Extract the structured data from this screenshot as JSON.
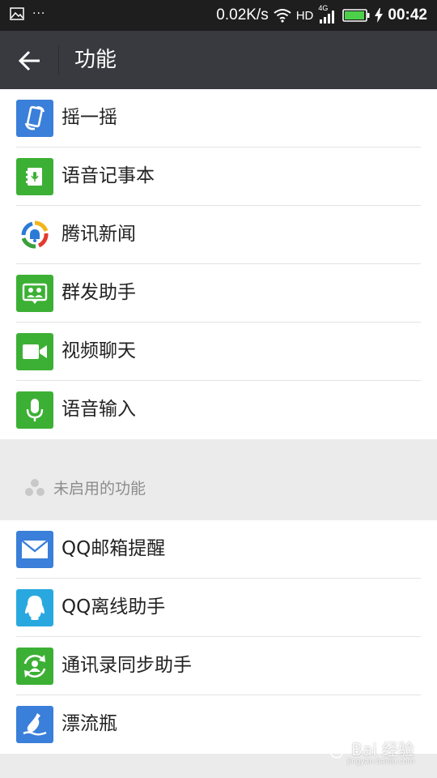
{
  "status_bar": {
    "left_icons": [
      "image-icon",
      "more-icon"
    ],
    "net_speed": "0.02K/s",
    "hd": "HD",
    "network": "4G",
    "time": "00:42"
  },
  "header": {
    "title": "功能"
  },
  "enabled_features": [
    {
      "label": "摇一摇",
      "icon": "shake-icon",
      "color": "#3a7fd9"
    },
    {
      "label": "语音记事本",
      "icon": "voice-notepad-icon",
      "color": "#3cb034"
    },
    {
      "label": "腾讯新闻",
      "icon": "tencent-news-icon",
      "color": "#ffffff"
    },
    {
      "label": "群发助手",
      "icon": "broadcast-icon",
      "color": "#3cb034"
    },
    {
      "label": "视频聊天",
      "icon": "video-chat-icon",
      "color": "#3cb034"
    },
    {
      "label": "语音输入",
      "icon": "microphone-icon",
      "color": "#3cb034"
    }
  ],
  "disabled_section": {
    "label": "未启用的功能"
  },
  "disabled_features": [
    {
      "label": "QQ邮箱提醒",
      "icon": "mail-icon",
      "color": "#3a7fd9"
    },
    {
      "label": "QQ离线助手",
      "icon": "qq-icon",
      "color": "#29a8e0"
    },
    {
      "label": "通讯录同步助手",
      "icon": "contacts-sync-icon",
      "color": "#3cb034"
    },
    {
      "label": "漂流瓶",
      "icon": "drift-bottle-icon",
      "color": "#3a7fd9"
    }
  ],
  "watermark": {
    "text": "Bai 经验",
    "sub": "jingyan.baidu.com"
  }
}
